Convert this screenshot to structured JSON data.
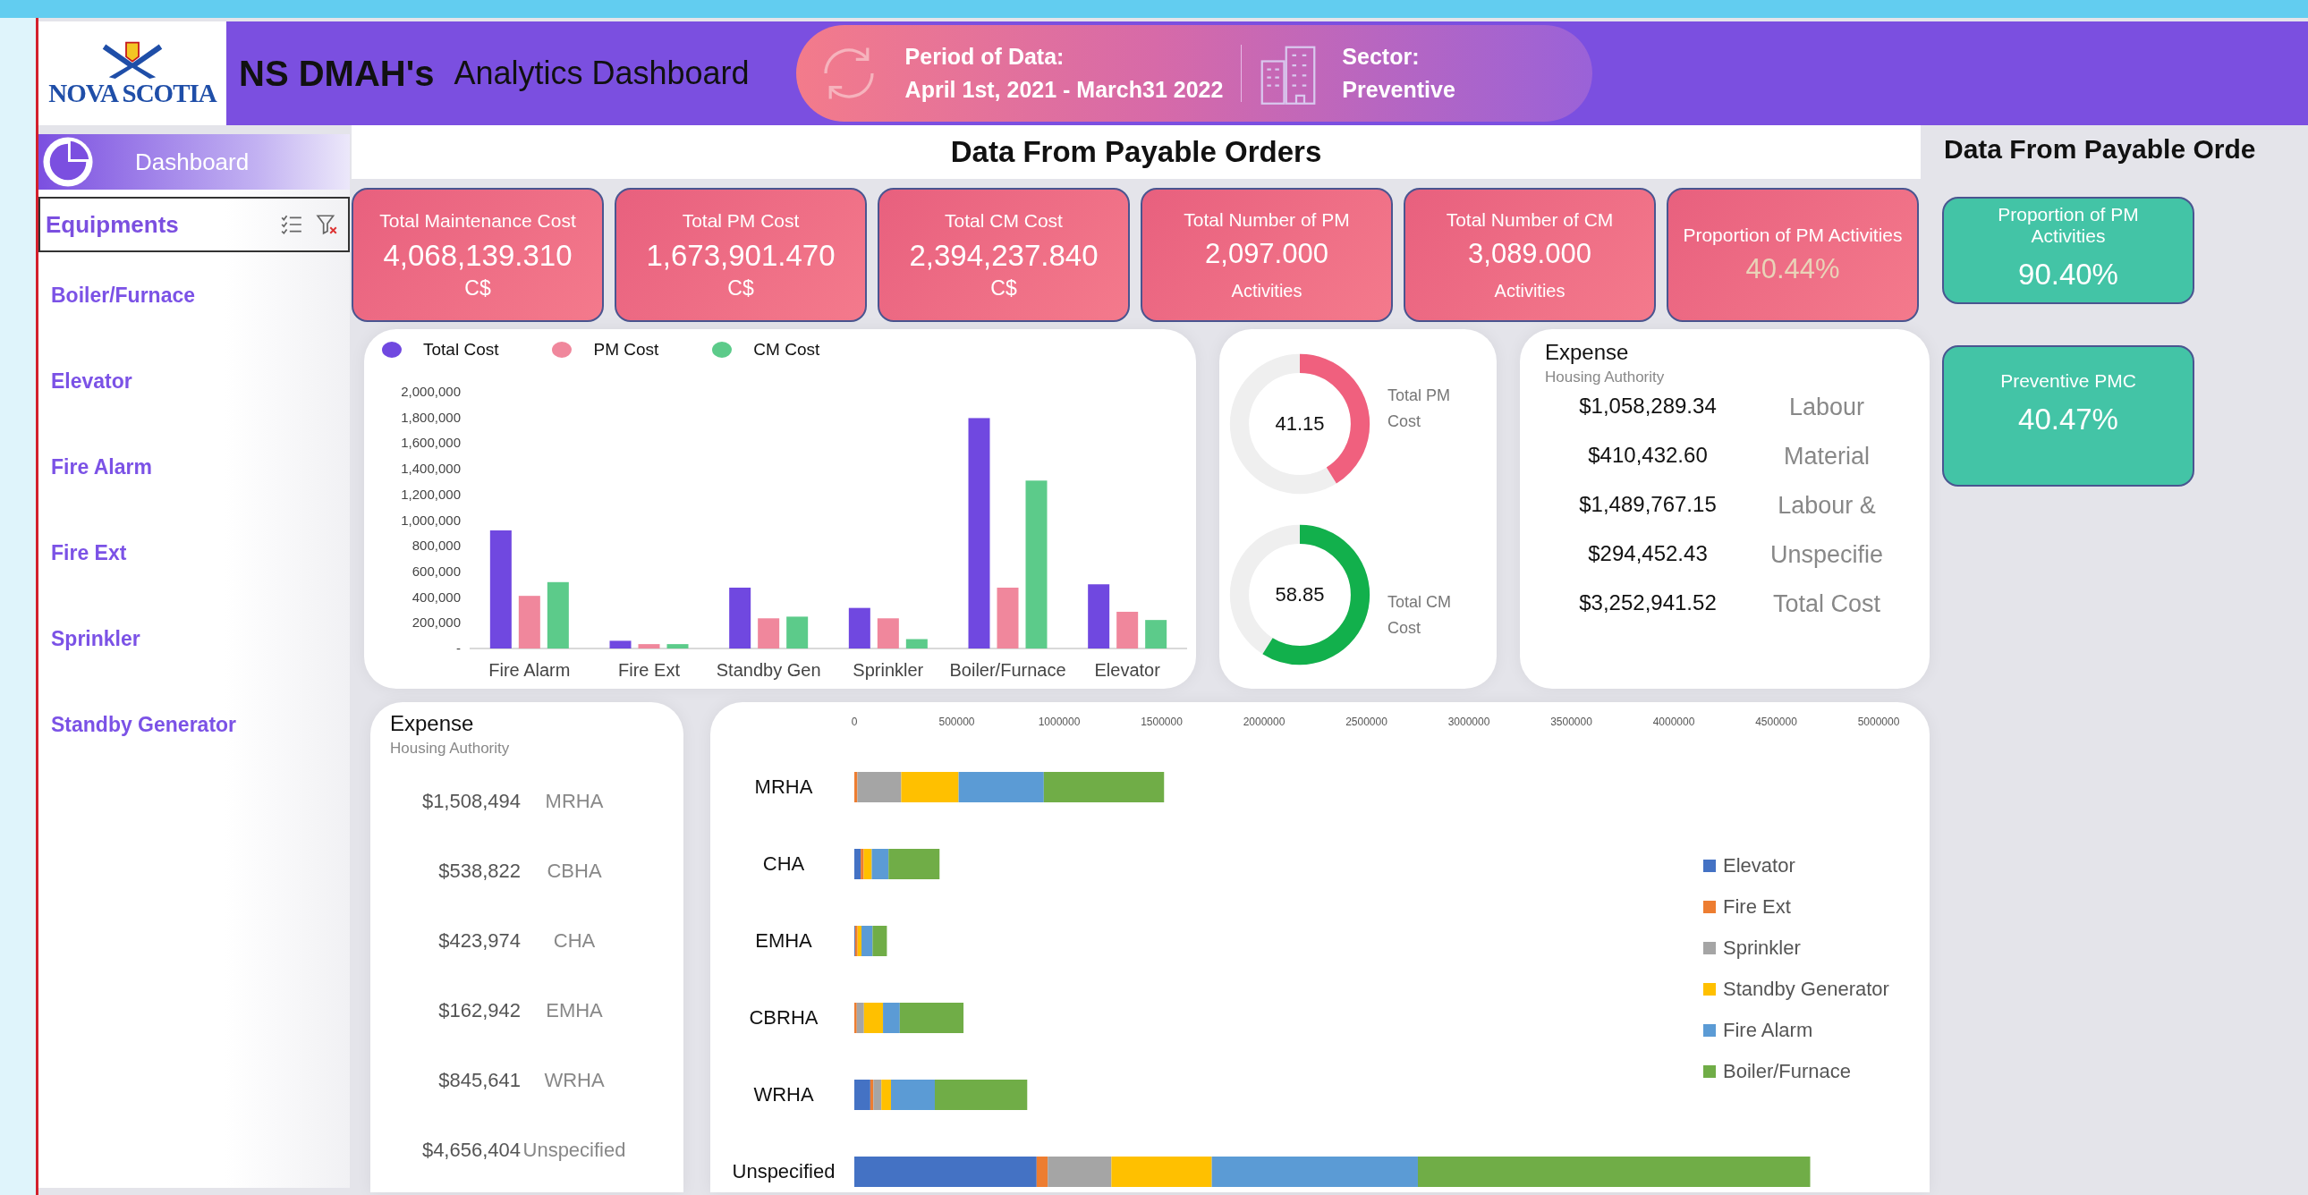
{
  "header": {
    "logo_text": "NOVA SCOTIA",
    "title_bold": "NS DMAH's",
    "title": "Analytics Dashboard",
    "period_label": "Period of Data:",
    "period_value": "April 1st, 2021 - March31 2022",
    "sector_label": "Sector:",
    "sector_value": "Preventive"
  },
  "sidebar": {
    "nav": [
      {
        "label": "Dashboard",
        "selected": true
      }
    ],
    "slicer": {
      "title": "Equipments",
      "items": [
        "Boiler/Furnace",
        "Elevator",
        "Fire Alarm",
        "Fire Ext",
        "Sprinkler",
        "Standby Generator"
      ]
    }
  },
  "section_title": "Data From Payable Orders",
  "kpis": [
    {
      "title": "Total Maintenance Cost",
      "value": "4,068,139.310",
      "unit": "C$",
      "kind": "amount"
    },
    {
      "title": "Total PM Cost",
      "value": "1,673,901.470",
      "unit": "C$",
      "kind": "amount"
    },
    {
      "title": "Total CM Cost",
      "value": "2,394,237.840",
      "unit": "C$",
      "kind": "amount"
    },
    {
      "title": "Total Number of PM",
      "value": "2,097.000",
      "unit": "Activities",
      "kind": "count"
    },
    {
      "title": "Total Number of CM",
      "value": "3,089.000",
      "unit": "Activities",
      "kind": "count"
    },
    {
      "title": "Proportion of PM Activities",
      "value": "40.44%",
      "kind": "percent"
    }
  ],
  "cost_chart": {
    "chart_data": {
      "type": "bar",
      "legend": "top",
      "categories": [
        "Fire Alarm",
        "Fire Ext",
        "Standby Gen",
        "Sprinkler",
        "Boiler/Furnace",
        "Elevator"
      ],
      "ylim": [
        0,
        2000000
      ],
      "yticks": [
        {
          "value": 0,
          "label": "-"
        },
        {
          "value": 200000,
          "label": "200,000"
        },
        {
          "value": 400000,
          "label": "400,000"
        },
        {
          "value": 600000,
          "label": "600,000"
        },
        {
          "value": 800000,
          "label": "800,000"
        },
        {
          "value": 1000000,
          "label": "1,000,000"
        },
        {
          "value": 1200000,
          "label": "1,200,000"
        },
        {
          "value": 1400000,
          "label": "1,400,000"
        },
        {
          "value": 1600000,
          "label": "1,600,000"
        },
        {
          "value": 1800000,
          "label": "1,800,000"
        },
        {
          "value": 2000000,
          "label": "2,000,000"
        }
      ],
      "series": [
        {
          "name": "Total Cost",
          "color": "#7048e0",
          "values": [
            920000,
            60000,
            474000,
            316000,
            1795000,
            500000
          ]
        },
        {
          "name": "PM Cost",
          "color": "#f0879c",
          "values": [
            410000,
            34000,
            235000,
            235000,
            474000,
            286000
          ]
        },
        {
          "name": "CM Cost",
          "color": "#5ccb8a",
          "values": [
            517000,
            34000,
            248000,
            73000,
            1308000,
            222000
          ]
        }
      ]
    }
  },
  "gauges": [
    {
      "value": "41.15",
      "level": 0.4115,
      "label": "Total PM Cost",
      "color": "#f0607e"
    },
    {
      "value": "58.85",
      "level": 0.5885,
      "label": "Total CM Cost",
      "color": "#12b04c"
    }
  ],
  "expense_types": {
    "title": "Expense",
    "subtitle": "Housing Authority",
    "rows": [
      {
        "amount": "$1,058,289.34",
        "label": "Labour"
      },
      {
        "amount": "$410,432.60",
        "label": "Material"
      },
      {
        "amount": "$1,489,767.15",
        "label": "Labour &"
      },
      {
        "amount": "$294,452.43",
        "label": "Unspecifie"
      },
      {
        "amount": "$3,252,941.52",
        "label": "Total Cost"
      }
    ]
  },
  "authority_expense": {
    "title": "Expense",
    "subtitle": "Housing Authority",
    "rows": [
      {
        "amount": "$1,508,494",
        "label": "MRHA"
      },
      {
        "amount": "$538,822",
        "label": "CBHA"
      },
      {
        "amount": "$423,974",
        "label": "CHA"
      },
      {
        "amount": "$162,942",
        "label": "EMHA"
      },
      {
        "amount": "$845,641",
        "label": "WRHA"
      },
      {
        "amount": "$4,656,404",
        "label": "Unspecified"
      }
    ]
  },
  "authority_chart": {
    "chart_data": {
      "type": "bar",
      "orientation": "horizontal",
      "stacked": true,
      "legend": "right",
      "categories": [
        "MRHA",
        "CHA",
        "EMHA",
        "CBRHA",
        "WRHA",
        "Unspecified"
      ],
      "xlim": [
        0,
        5000000
      ],
      "xticks": [
        0,
        500000,
        1000000,
        1500000,
        2000000,
        2500000,
        3000000,
        3500000,
        4000000,
        4500000,
        5000000
      ],
      "series": [
        {
          "name": "Elevator",
          "color": "#4472c4",
          "values": [
            0,
            31000,
            4000,
            0,
            78000,
            890000
          ]
        },
        {
          "name": "Fire Ext",
          "color": "#ed7d31",
          "values": [
            15000,
            15000,
            12000,
            12000,
            15000,
            54000
          ]
        },
        {
          "name": "Sprinkler",
          "color": "#a5a5a5",
          "values": [
            214000,
            null,
            null,
            35000,
            39000,
            311000
          ]
        },
        {
          "name": "Standby Generator",
          "color": "#ffc000",
          "values": [
            280000,
            39000,
            19000,
            93000,
            47000,
            490000
          ]
        },
        {
          "name": "Fire Alarm",
          "color": "#5b9bd5",
          "values": [
            416000,
            82000,
            54000,
            82000,
            214000,
            1006000
          ]
        },
        {
          "name": "Boiler/Furnace",
          "color": "#70ad47",
          "values": [
            587000,
            249000,
            70000,
            311000,
            451000,
            1915000
          ]
        }
      ]
    }
  },
  "side_panel": {
    "title": "Data From Payable Orde",
    "cards": [
      {
        "title": "Proportion of PM Activities",
        "value": "90.40%"
      },
      {
        "title": "Preventive PMC",
        "value": "40.47%"
      }
    ]
  }
}
